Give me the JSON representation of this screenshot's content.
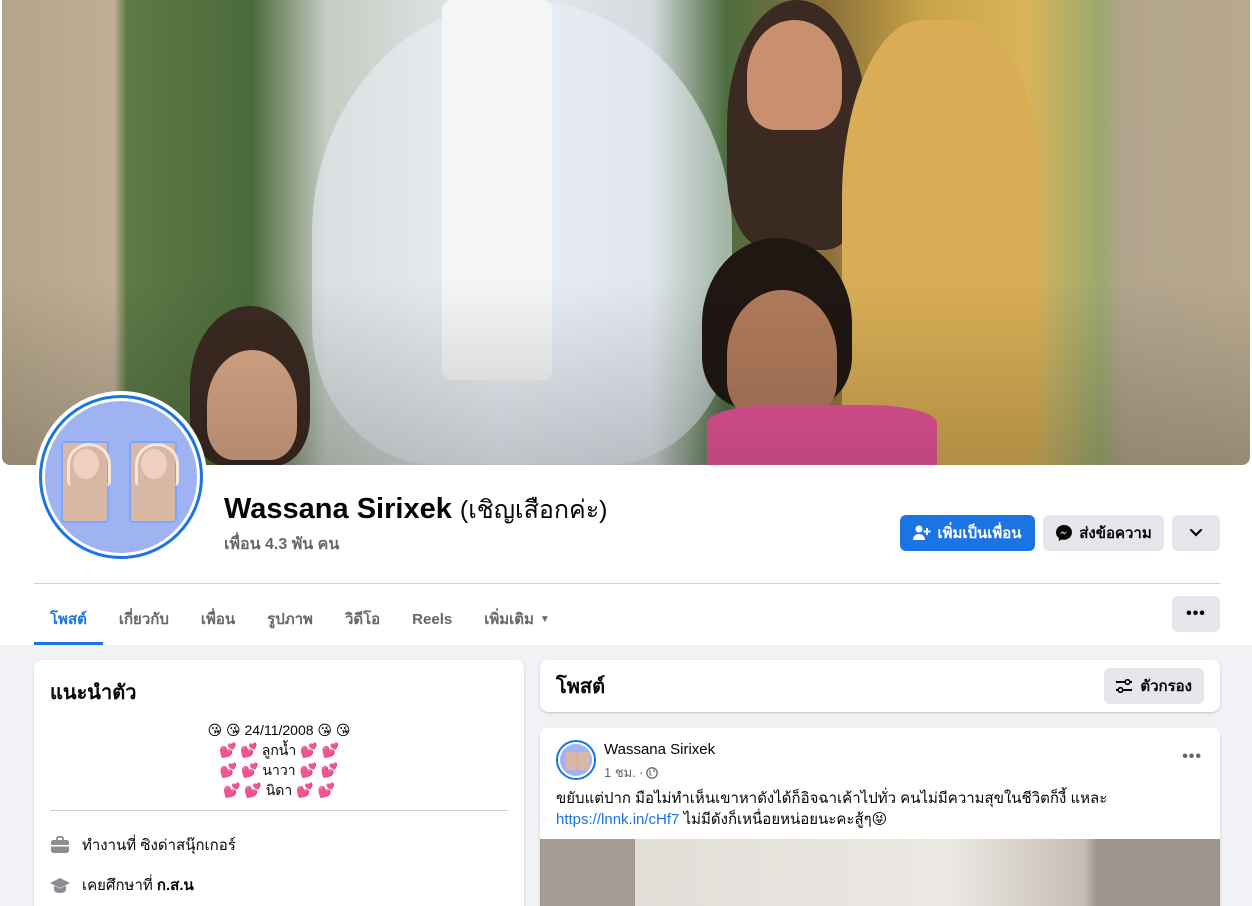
{
  "profile": {
    "name": "Wassana Sirixek",
    "alt_name": "(เชิญเสือกค่ะ)",
    "friends": "เพื่อน 4.3 พัน คน"
  },
  "actions": {
    "add_friend": "เพิ่มเป็นเพื่อน",
    "message": "ส่งข้อความ"
  },
  "tabs": [
    {
      "label": "โพสต์",
      "active": true
    },
    {
      "label": "เกี่ยวกับ"
    },
    {
      "label": "เพื่อน"
    },
    {
      "label": "รูปภาพ"
    },
    {
      "label": "วิดีโอ"
    },
    {
      "label": "Reels"
    },
    {
      "label": "เพิ่มเติม"
    }
  ],
  "intro": {
    "title": "แนะนำตัว",
    "bio_lines": [
      "😘 😘 24/11/2008 😘 😘",
      "💕 💕 ลูกน้ำ 💕 💕",
      "💕 💕 นาวา 💕 💕",
      "💕 💕 นิดา 💕 💕"
    ],
    "work_prefix": "ทำงานที่ ",
    "work_value": "ซิงด่าสนุ๊กเกอร์",
    "edu_prefix": "เคยศึกษาที่ ",
    "edu_value": "ก.ส.น"
  },
  "posts_section": {
    "title": "โพสต์",
    "filter_label": "ตัวกรอง"
  },
  "post": {
    "author": "Wassana Sirixek",
    "time": "1 ชม.",
    "text_line1": "ขยับแต่ปาก มือไม่ทำเห็นเขาหาดังได้ก็อิจฉาเค้าไปทั่ว คนไม่มีความสุขในชีวิตก็งี้ แหละ",
    "link": "https://lnnk.in/cHf7",
    "text_after_link": " ไม่มีดังก็เหนื่อยหน่อยนะคะสู้ๆ😝"
  },
  "colors": {
    "accent": "#1b74e4",
    "background": "#f0f2f5",
    "secondary_button": "#e4e6eb",
    "muted_text": "#65676b"
  }
}
